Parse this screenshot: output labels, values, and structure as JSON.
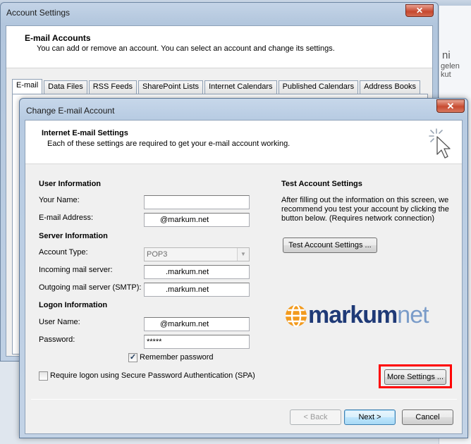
{
  "background": {
    "fragments": [
      "ni",
      "gelen kut"
    ]
  },
  "account_settings": {
    "title": "Account Settings",
    "close_glyph": "✕",
    "header_title": "E-mail Accounts",
    "header_desc": "You can add or remove an account. You can select an account and change its settings.",
    "tabs": [
      "E-mail",
      "Data Files",
      "RSS Feeds",
      "SharePoint Lists",
      "Internet Calendars",
      "Published Calendars",
      "Address Books"
    ],
    "active_tab": "E-mail"
  },
  "dialog": {
    "title": "Change E-mail Account",
    "close_glyph": "✕",
    "header_title": "Internet E-mail Settings",
    "header_desc": "Each of these settings are required to get your e-mail account working.",
    "user_info": {
      "heading": "User Information",
      "your_name_label": "Your Name:",
      "your_name_value": "",
      "email_label": "E-mail Address:",
      "email_value": "@markum.net"
    },
    "server_info": {
      "heading": "Server Information",
      "account_type_label": "Account Type:",
      "account_type_value": "POP3",
      "incoming_label": "Incoming mail server:",
      "incoming_value": ".markum.net",
      "outgoing_label": "Outgoing mail server (SMTP):",
      "outgoing_value": ".markum.net"
    },
    "logon_info": {
      "heading": "Logon Information",
      "user_name_label": "User Name:",
      "user_name_value": "@markum.net",
      "password_label": "Password:",
      "password_value": "*****",
      "remember_label": "Remember password",
      "remember_checked": true,
      "spa_label": "Require logon using Secure Password Authentication (SPA)",
      "spa_checked": false
    },
    "test": {
      "heading": "Test Account Settings",
      "desc": "After filling out the information on this screen, we recommend you test your account by clicking the button below. (Requires network connection)",
      "button": "Test Account Settings ..."
    },
    "logo": {
      "part_a": "markum",
      "part_b": "net"
    },
    "more_settings_button": "More Settings ...",
    "buttons": {
      "back": "< Back",
      "next": "Next >",
      "cancel": "Cancel"
    },
    "highlight_color": "#ff0000"
  }
}
